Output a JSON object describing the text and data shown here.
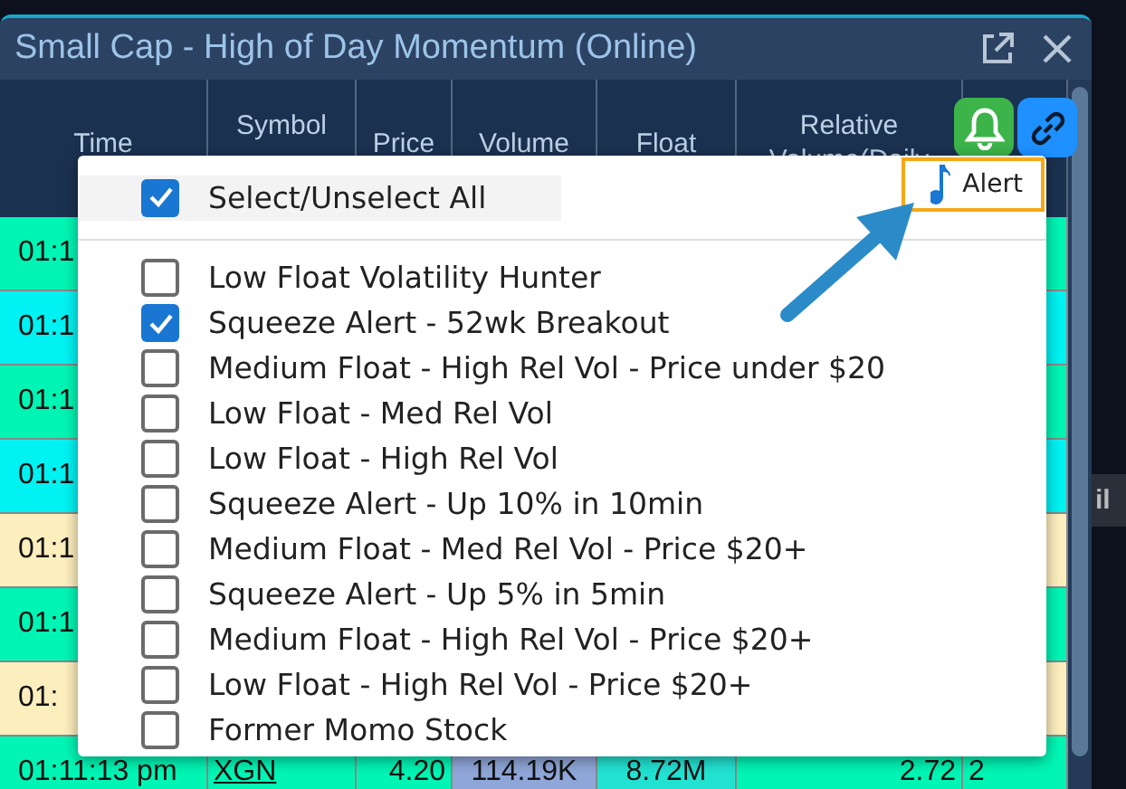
{
  "window": {
    "title": "Small Cap - High of Day Momentum (Online)"
  },
  "table": {
    "columns": [
      "Time",
      "Symbol",
      "Price",
      "Volume",
      "Float",
      "Relative Volume(Daily"
    ],
    "rows": [
      {
        "color": "#00f5b4",
        "cells": [
          {
            "text": "01:1"
          }
        ]
      },
      {
        "color": "#00f2f2",
        "cells": [
          {
            "text": "01:1"
          }
        ]
      },
      {
        "color": "#00f5b4",
        "cells": [
          {
            "text": "01:1"
          }
        ]
      },
      {
        "color": "#00f2f2",
        "cells": [
          {
            "text": "01:1"
          }
        ]
      },
      {
        "color": "#fdeebe",
        "cells": [
          {
            "text": "01:1"
          }
        ]
      },
      {
        "color": "#00f5b4",
        "cells": [
          {
            "text": "01:1"
          }
        ]
      },
      {
        "color": "#fdeebe",
        "cells": [
          {
            "text": "01:"
          }
        ]
      },
      {
        "color": "#00f5b4",
        "cells": [
          {
            "text": "01:11:13 pm"
          },
          {
            "text": "XGN",
            "kind": "link"
          },
          {
            "text": "4.20"
          },
          {
            "text": "114.19K",
            "color": "#8fa6d8"
          },
          {
            "text": "8.72M",
            "color": "#22e2d2"
          },
          {
            "text": "2.72"
          },
          {
            "text": "2"
          }
        ]
      }
    ]
  },
  "popup": {
    "select_all": {
      "label": "Select/Unselect All",
      "checked": true
    },
    "alert_button": {
      "label": "Alert"
    },
    "filters": [
      {
        "label": "Low Float Volatility Hunter",
        "checked": false
      },
      {
        "label": "Squeeze Alert - 52wk Breakout",
        "checked": true
      },
      {
        "label": "Medium Float - High Rel Vol - Price under $20",
        "checked": false
      },
      {
        "label": "Low Float - Med Rel Vol",
        "checked": false
      },
      {
        "label": "Low Float - High Rel Vol",
        "checked": false
      },
      {
        "label": "Squeeze Alert - Up 10% in 10min",
        "checked": false
      },
      {
        "label": "Medium Float - Med Rel Vol - Price $20+",
        "checked": false
      },
      {
        "label": "Squeeze Alert - Up 5% in 5min",
        "checked": false
      },
      {
        "label": "Medium Float - High Rel Vol - Price $20+",
        "checked": false
      },
      {
        "label": "Low Float - High Rel Vol - Price $20+",
        "checked": false
      },
      {
        "label": "Former Momo Stock",
        "checked": false
      }
    ]
  },
  "side_panel": {
    "text": "il"
  }
}
